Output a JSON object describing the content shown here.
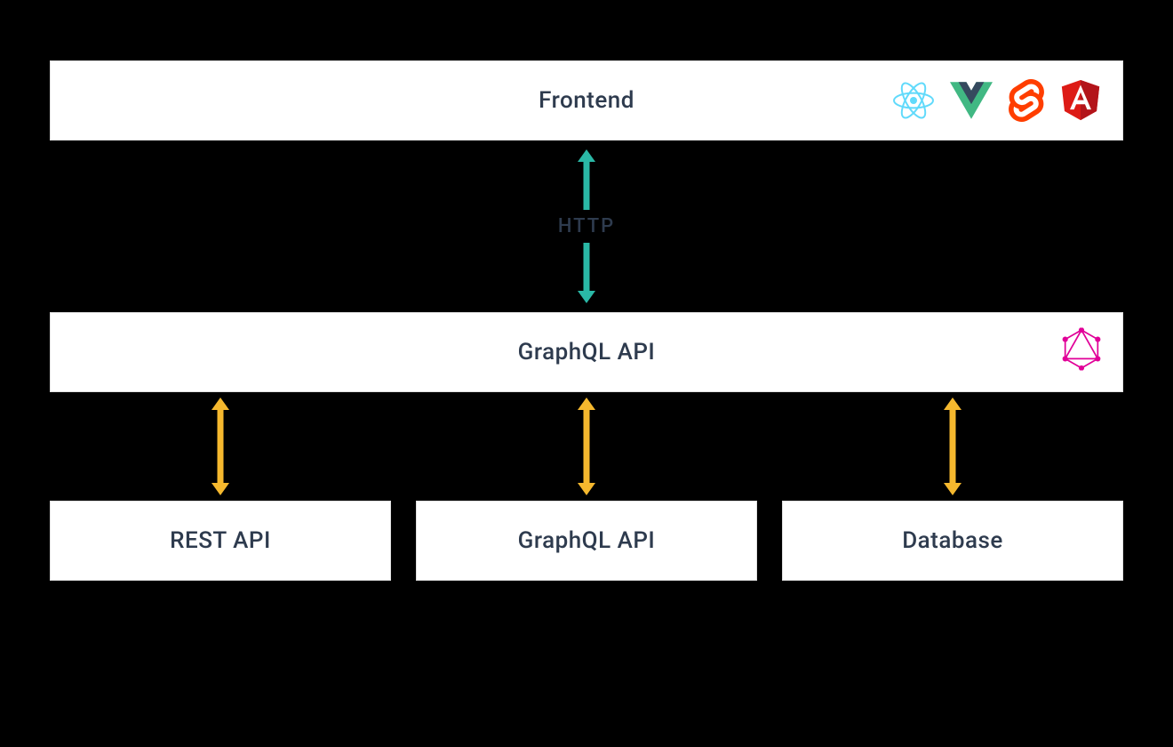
{
  "frontend": {
    "label": "Frontend",
    "icons": [
      "react",
      "vue",
      "svelte",
      "angular"
    ]
  },
  "connection_top": {
    "label": "HTTP",
    "color": "#2ab8a6"
  },
  "graphql_api": {
    "label": "GraphQL API"
  },
  "connection_bottom": {
    "color": "#f5b82e"
  },
  "backends": [
    {
      "label": "REST API"
    },
    {
      "label": "GraphQL API"
    },
    {
      "label": "Database"
    }
  ],
  "colors": {
    "react": "#61dafb",
    "vue_dark": "#35495e",
    "vue_green": "#41b883",
    "svelte": "#ff3e00",
    "angular_red": "#dd1b16",
    "angular_dark": "#b3141a",
    "graphql": "#e10098"
  }
}
